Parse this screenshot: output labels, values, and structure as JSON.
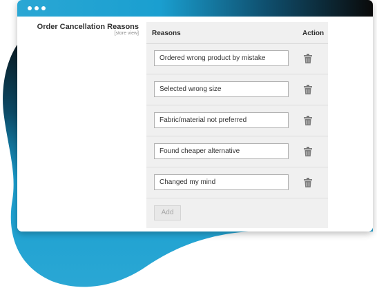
{
  "colors": {
    "accent_blue": "#1a9fd0",
    "dark": "#0a0a0a",
    "panel_bg": "#f0f0f0",
    "text": "#303030"
  },
  "window": {
    "controls": [
      "dot",
      "dot",
      "dot"
    ]
  },
  "field": {
    "label": "Order Cancellation Reasons",
    "scope": "[store view]"
  },
  "table": {
    "headers": {
      "reasons": "Reasons",
      "action": "Action"
    },
    "rows": [
      {
        "value": "Ordered wrong product by mistake",
        "action_icon": "trash-icon"
      },
      {
        "value": "Selected wrong size",
        "action_icon": "trash-icon"
      },
      {
        "value": "Fabric/material not preferred",
        "action_icon": "trash-icon"
      },
      {
        "value": "Found cheaper alternative",
        "action_icon": "trash-icon"
      },
      {
        "value": "Changed my mind",
        "action_icon": "trash-icon"
      }
    ],
    "add_label": "Add"
  }
}
